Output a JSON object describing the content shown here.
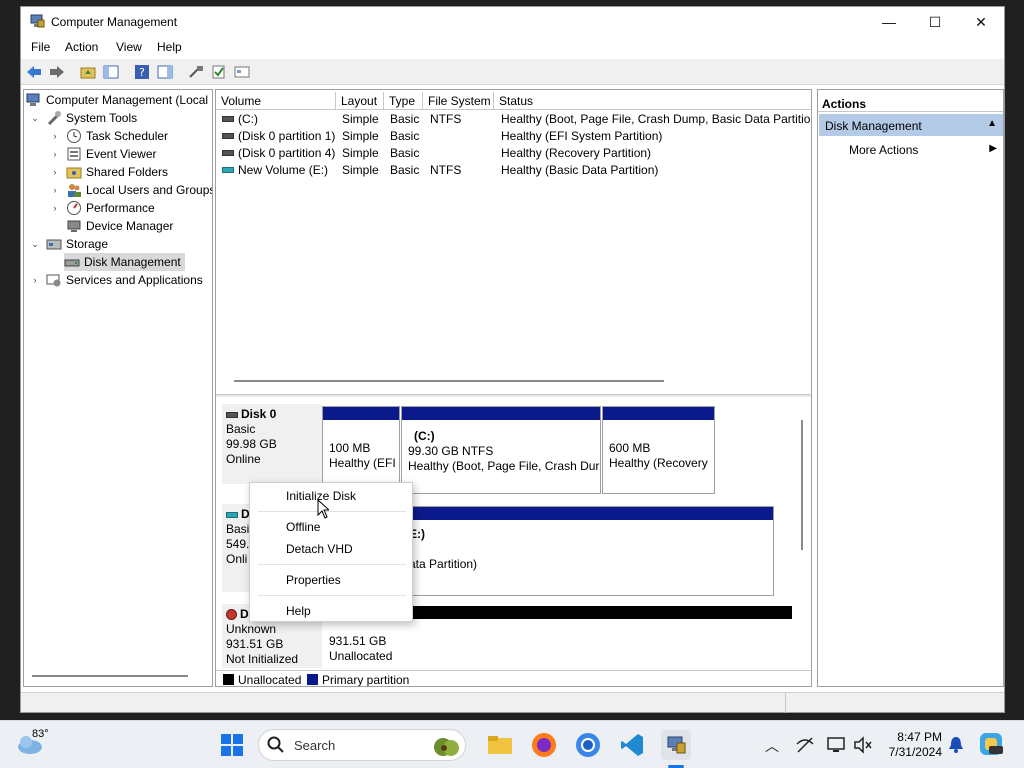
{
  "window": {
    "title": "Computer Management",
    "minimize": "—",
    "maximize": "☐",
    "close": "✕"
  },
  "menu": {
    "file": "File",
    "action": "Action",
    "view": "View",
    "help": "Help"
  },
  "toolbar": {
    "icons": [
      "back-arrow-icon",
      "forward-arrow-icon",
      "up-folder-icon",
      "show-hide-tree-icon",
      "help-icon",
      "show-hide-action-pane-icon",
      "connect-icon",
      "checklist-icon",
      "properties-icon"
    ]
  },
  "tree": {
    "root": "Computer Management (Local",
    "system_tools": "System Tools",
    "task_scheduler": "Task Scheduler",
    "event_viewer": "Event Viewer",
    "shared_folders": "Shared Folders",
    "local_users": "Local Users and Groups",
    "performance": "Performance",
    "device_manager": "Device Manager",
    "storage": "Storage",
    "disk_management": "Disk Management",
    "services": "Services and Applications"
  },
  "volume_list": {
    "headers": [
      "Volume",
      "Layout",
      "Type",
      "File System",
      "Status"
    ],
    "rows": [
      {
        "volume": "(C:)",
        "layout": "Simple",
        "type": "Basic",
        "fs": "NTFS",
        "status": "Healthy (Boot, Page File, Crash Dump, Basic Data Partition)"
      },
      {
        "volume": "(Disk 0 partition 1)",
        "layout": "Simple",
        "type": "Basic",
        "fs": "",
        "status": "Healthy (EFI System Partition)"
      },
      {
        "volume": "(Disk 0 partition 4)",
        "layout": "Simple",
        "type": "Basic",
        "fs": "",
        "status": "Healthy (Recovery Partition)"
      },
      {
        "volume": "New Volume (E:)",
        "layout": "Simple",
        "type": "Basic",
        "fs": "NTFS",
        "status": "Healthy (Basic Data Partition)"
      }
    ]
  },
  "disks": {
    "disk0": {
      "name": "Disk 0",
      "type": "Basic",
      "size": "99.98 GB",
      "state": "Online",
      "partitions": [
        {
          "title": "",
          "size": "100 MB",
          "status": "Healthy (EFI"
        },
        {
          "title": "(C:)",
          "size": "99.30 GB NTFS",
          "status": "Healthy (Boot, Page File, Crash Dur"
        },
        {
          "title": "",
          "size": "600 MB",
          "status": "Healthy (Recovery"
        }
      ]
    },
    "disk1": {
      "name": "D",
      "type": "Basic",
      "size": "549.",
      "state": "Onli",
      "partition_title": "E:)",
      "partition_status": "ata Partition)"
    },
    "disk2": {
      "name": "D",
      "type": "Unknown",
      "size": "931.51 GB",
      "state": "Not Initialized",
      "part_size": "931.51 GB",
      "part_status": "Unallocated"
    }
  },
  "legend": {
    "unallocated": "Unallocated",
    "primary": "Primary partition",
    "unallocated_color": "#000000",
    "primary_color": "#0a1a8c"
  },
  "actions": {
    "header": "Actions",
    "section": "Disk Management",
    "more": "More Actions"
  },
  "context_menu": {
    "initialize": "Initialize Disk",
    "offline": "Offline",
    "detach": "Detach VHD",
    "properties": "Properties",
    "help": "Help"
  },
  "taskbar": {
    "temperature": "83°",
    "search_placeholder": "Search",
    "time": "8:47 PM",
    "date": "7/31/2024"
  }
}
